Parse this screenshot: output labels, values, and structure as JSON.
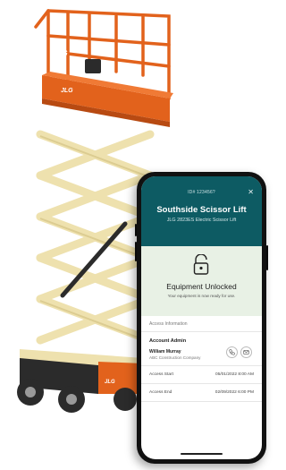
{
  "lift": {
    "brand": "JLG",
    "colors": {
      "platform": "#e2621c",
      "scissor": "#eee1ae",
      "base": "#e2621c",
      "tire": "#2b2b2b"
    }
  },
  "app": {
    "equipment_id": "ID# 123456?",
    "title": "Southside Scissor Lift",
    "subtitle": "JLG 2823ES Electric Scissor Lift",
    "close_icon": "close-icon",
    "unlock": {
      "icon": "unlocked-padlock-icon",
      "title": "Equipment Unlocked",
      "message": "Your equipment is now ready for use."
    },
    "access_section_label": "Access Information",
    "account_admin": {
      "heading": "Account Admin",
      "name": "William Murray",
      "company": "ABC Construction Company",
      "actions": [
        "phone-icon",
        "message-icon"
      ]
    },
    "access_start": {
      "label": "Access Start",
      "value": "05/01/2022 8:00 AM"
    },
    "access_end": {
      "label": "Access End",
      "value": "02/09/2022 6:00 PM"
    },
    "colors": {
      "header": "#0d5b63",
      "unlock_card": "#e8f1e5"
    }
  }
}
